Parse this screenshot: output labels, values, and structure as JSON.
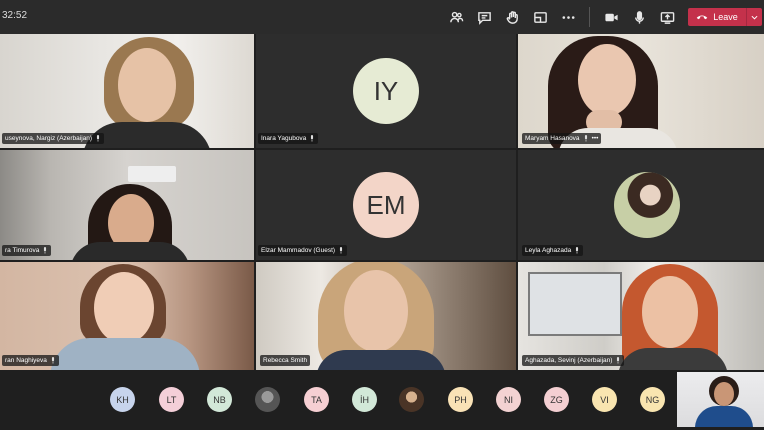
{
  "meeting": {
    "timer": "32:52",
    "leave_label": "Leave"
  },
  "toolbar_icons": [
    "participants-icon",
    "chat-icon",
    "raise-hand-icon",
    "share-tray-icon",
    "more-actions-icon",
    "camera-icon",
    "microphone-icon",
    "share-screen-icon"
  ],
  "tiles": [
    {
      "name": "useynova, Nargiz (Azerbaijan)",
      "type": "video"
    },
    {
      "name": "Inara Yagubova",
      "type": "avatar",
      "initials": "IY",
      "color": "#e6ebd4"
    },
    {
      "name": "Maryam Hasanova",
      "type": "video",
      "more": "•••"
    },
    {
      "name": "ra Timurova",
      "type": "video"
    },
    {
      "name": "Elzar Mammadov (Guest)",
      "type": "avatar",
      "initials": "EM",
      "color": "#f3d5c8"
    },
    {
      "name": "Leyla Aghazada",
      "type": "photo"
    },
    {
      "name": "ran Naghiyeva",
      "type": "video"
    },
    {
      "name": "Rebecca Smith",
      "type": "video"
    },
    {
      "name": "Aghazada, Sevinj (Azerbaijan)",
      "type": "video"
    }
  ],
  "participants_bar": [
    {
      "initials": "KH",
      "color": "#c7d4ec"
    },
    {
      "initials": "LT",
      "color": "#f4cfd8"
    },
    {
      "initials": "NB",
      "color": "#d2e8d8"
    },
    {
      "initials": "",
      "color": "#6b6b6b",
      "photo": true
    },
    {
      "initials": "TA",
      "color": "#f6cfd3"
    },
    {
      "initials": "İH",
      "color": "#d2e8d8"
    },
    {
      "initials": "",
      "color": "#8a6a4a",
      "photo": true
    },
    {
      "initials": "PH",
      "color": "#f9e2b6"
    },
    {
      "initials": "NI",
      "color": "#f3d2d2"
    },
    {
      "initials": "ZG",
      "color": "#f4cfd2"
    },
    {
      "initials": "VI",
      "color": "#f9e5b0"
    },
    {
      "initials": "NG",
      "color": "#f9e5b0"
    }
  ]
}
